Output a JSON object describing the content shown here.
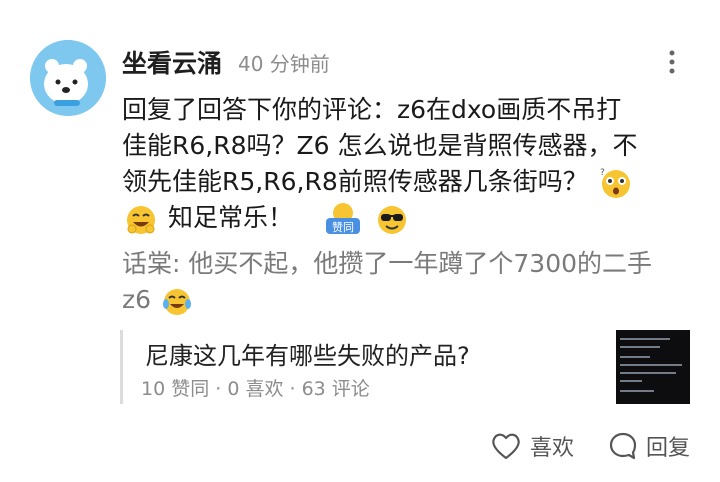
{
  "comment": {
    "author": "坐看云涌",
    "time": "40 分钟前",
    "text_line1": "回复了回答下你的评论：z6在dxo画质不吊打",
    "text_line2": "佳能R6,R8吗？Z6 怎么说也是背照传感器，不",
    "text_line3": "领先佳能R5,R6,R8前照传感器几条街吗？",
    "text_line4": "知足常乐！",
    "sticker_text": "赞同"
  },
  "quoted": {
    "author": "话棠",
    "text_line1": "他买不起，他攒了一年蹲了个7300的二手",
    "text_line2": "z6"
  },
  "card": {
    "title": "尼康这几年有哪些失败的产品?",
    "stats": "10 赞同 · 0 喜欢 · 63 评论"
  },
  "actions": {
    "like_label": "喜欢",
    "reply_label": "回复"
  },
  "icons": {
    "more": "more-vertical-icon",
    "heart": "heart-icon",
    "reply": "comment-bubble-icon"
  },
  "colors": {
    "avatar_bg": "#7ec8f0",
    "muted_text": "#8c8c8c",
    "emoji_yellow": "#f7c531"
  }
}
